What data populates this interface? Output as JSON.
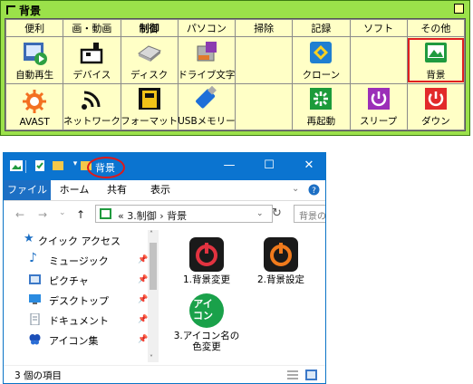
{
  "launcher": {
    "title": "背景",
    "columns": [
      "便利",
      "画・動画",
      "制御",
      "パソコン",
      "掃除",
      "記録",
      "ソフト",
      "その他"
    ],
    "row1": [
      "自動再生",
      "デバイス",
      "ディスク",
      "ドライブ文字",
      "",
      "クローン",
      "",
      "背景"
    ],
    "row2": [
      "AVAST",
      "ネットワーク",
      "フォーマット",
      "USBメモリー",
      "",
      "再起動",
      "スリープ",
      "ダウン"
    ]
  },
  "explorer": {
    "title": "背景",
    "tabs": [
      "ファイル",
      "ホーム",
      "共有",
      "表示"
    ],
    "breadcrumb": "«  3.制御  ›  背景",
    "search_placeholder": "背景の",
    "nav_items": [
      "クイック アクセス",
      "ミュージック",
      "ピクチャ",
      "デスクトップ",
      "ドキュメント",
      "アイコン集"
    ],
    "files": [
      "1.背景変更",
      "2.背景設定",
      "3.アイコン名の色変更"
    ],
    "icon_label": "アイ\nコン",
    "status": "3 個の項目"
  }
}
